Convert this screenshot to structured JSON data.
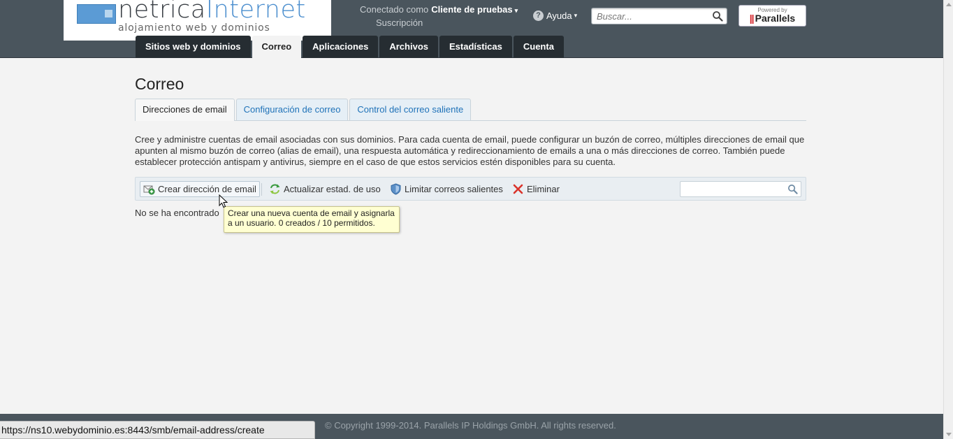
{
  "header": {
    "logo": {
      "name_part1": "netrica",
      "name_part2": "Internet",
      "tagline": "alojamiento web y dominios"
    },
    "login": {
      "connected_as_label": "Conectado como",
      "user": "Cliente de pruebas",
      "subscription": "Suscripción"
    },
    "help_label": "Ayuda",
    "search": {
      "placeholder": "Buscar...",
      "icon": "search-icon"
    },
    "powered_by": {
      "small": "Powered by",
      "brand": "Parallels"
    }
  },
  "main_tabs": [
    {
      "label": "Sitios web y dominios",
      "active": false
    },
    {
      "label": "Correo",
      "active": true
    },
    {
      "label": "Aplicaciones",
      "active": false
    },
    {
      "label": "Archivos",
      "active": false
    },
    {
      "label": "Estadísticas",
      "active": false
    },
    {
      "label": "Cuenta",
      "active": false
    }
  ],
  "page": {
    "title": "Correo",
    "subtabs": [
      {
        "label": "Direcciones de email",
        "active": true
      },
      {
        "label": "Configuración de correo",
        "active": false
      },
      {
        "label": "Control del correo saliente",
        "active": false
      }
    ],
    "description": "Cree y administre cuentas de email asociadas con sus dominios. Para cada cuenta de email, puede configurar un buzón de correo, múltiples direcciones de email que apunten al mismo buzón de correo (alias de email), una respuesta automática y redireccionamiento de emails a una o más direcciones de correo. También puede establecer protección antispam y antivirus, siempre en el caso de que estos servicios estén disponibles para su cuenta.",
    "toolbar": {
      "create": "Crear dirección de email",
      "refresh": "Actualizar estad. de uso",
      "limit": "Limitar correos salientes",
      "delete": "Eliminar"
    },
    "empty_message": "No se ha encontrado",
    "tooltip": "Crear una nueva cuenta de email y asignarla a un usuario. 0 creados / 10 permitidos."
  },
  "footer": {
    "copyright": "© Copyright 1999-2014. Parallels IP Holdings GmbH. All rights reserved."
  },
  "statusbar": {
    "url": "https://ns10.webydominio.es:8443/smb/email-address/create"
  },
  "colors": {
    "header_bg": "#4a555d",
    "tab_dark": "#262d32",
    "link_blue": "#1f72b8",
    "tooltip_bg": "#ffffd2"
  }
}
